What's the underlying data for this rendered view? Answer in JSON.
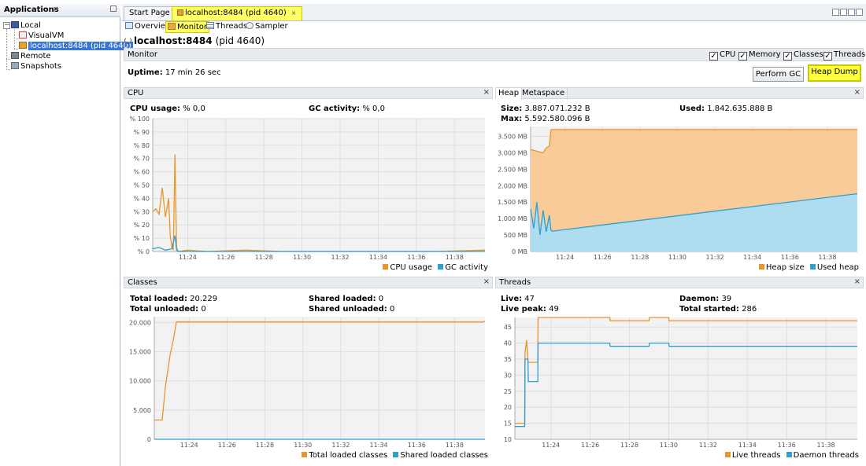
{
  "left_panel": {
    "title": "Applications",
    "close": "×",
    "items": [
      {
        "label": "Local"
      },
      {
        "label": "VisualVM"
      },
      {
        "label": "localhost:8484 (pid 4640)"
      },
      {
        "label": "Remote"
      },
      {
        "label": "Snapshots"
      }
    ]
  },
  "tabs": [
    {
      "label": "Start Page",
      "close": "×"
    },
    {
      "label": "localhost:8484 (pid 4640)",
      "close": "×"
    }
  ],
  "subtabs": [
    {
      "label": "Overview"
    },
    {
      "label": "Monitor"
    },
    {
      "label": "Threads"
    },
    {
      "label": "Sampler"
    }
  ],
  "vm": {
    "title": "localhost:8484",
    "pid": "(pid 4640)"
  },
  "monitor": {
    "label": "Monitor",
    "checkboxes": [
      {
        "label": "CPU",
        "checked": true
      },
      {
        "label": "Memory",
        "checked": true
      },
      {
        "label": "Classes",
        "checked": true
      },
      {
        "label": "Threads",
        "checked": true
      }
    ],
    "uptime_label": "Uptime:",
    "uptime_value": "17 min 26 sec",
    "perform_gc": "Perform GC",
    "heap_dump": "Heap Dump"
  },
  "panels": {
    "cpu": {
      "title": "CPU",
      "close": "×",
      "stats": [
        {
          "label": "CPU usage:",
          "value": "% 0,0"
        },
        {
          "label": "GC activity:",
          "value": "% 0,0"
        }
      ],
      "legend": [
        {
          "label": "CPU usage",
          "color": "#e8962c"
        },
        {
          "label": "GC activity",
          "color": "#2f9fd0"
        }
      ]
    },
    "heap": {
      "tabs": [
        "Heap",
        "Metaspace"
      ],
      "close": "×",
      "stats": [
        {
          "label": "Size:",
          "value": "3.887.071.232 B"
        },
        {
          "label": "Used:",
          "value": "1.842.635.888 B"
        },
        {
          "label": "Max:",
          "value": "5.592.580.096 B"
        }
      ],
      "legend": [
        {
          "label": "Heap size",
          "color": "#e8962c"
        },
        {
          "label": "Used heap",
          "color": "#2f9fd0"
        }
      ]
    },
    "classes": {
      "title": "Classes",
      "close": "×",
      "stats": [
        {
          "label": "Total loaded:",
          "value": "20.229"
        },
        {
          "label": "Shared loaded:",
          "value": "0"
        },
        {
          "label": "Total unloaded:",
          "value": "0"
        },
        {
          "label": "Shared unloaded:",
          "value": "0"
        }
      ],
      "legend": [
        {
          "label": "Total loaded classes",
          "color": "#e8962c"
        },
        {
          "label": "Shared loaded classes",
          "color": "#2f9fd0"
        }
      ]
    },
    "threads": {
      "title": "Threads",
      "close": "×",
      "stats": [
        {
          "label": "Live:",
          "value": "47"
        },
        {
          "label": "Daemon:",
          "value": "39"
        },
        {
          "label": "Live peak:",
          "value": "49"
        },
        {
          "label": "Total started:",
          "value": "286"
        }
      ],
      "legend": [
        {
          "label": "Live threads",
          "color": "#e8962c"
        },
        {
          "label": "Daemon threads",
          "color": "#2f9fd0"
        }
      ]
    }
  },
  "chart_data": [
    {
      "id": "cpu",
      "type": "line",
      "x_ticks": [
        "11:24",
        "11:26",
        "11:28",
        "11:30",
        "11:32",
        "11:34",
        "11:36",
        "11:38"
      ],
      "y_ticks": [
        "% 0",
        "% 10",
        "% 20",
        "% 30",
        "% 40",
        "% 50",
        "% 60",
        "% 70",
        "% 80",
        "% 90",
        "% 100"
      ],
      "x_range": [
        "11:22:10",
        "11:39:36"
      ],
      "ylim": [
        0,
        100
      ],
      "grid": true,
      "legend_position": "bottom-right",
      "series": [
        {
          "name": "CPU usage",
          "color": "#e8962c",
          "x": [
            "11:22:10",
            "11:22:20",
            "11:22:30",
            "11:22:40",
            "11:22:50",
            "11:23:00",
            "11:23:05",
            "11:23:10",
            "11:23:15",
            "11:23:20",
            "11:23:25",
            "11:23:30",
            "11:24:00",
            "11:25:00",
            "11:27:00",
            "11:29:00",
            "11:31:00",
            "11:33:00",
            "11:35:00",
            "11:37:00",
            "11:39:36"
          ],
          "values": [
            30,
            32,
            28,
            48,
            26,
            40,
            12,
            4,
            1,
            73,
            3,
            0,
            1,
            0,
            1,
            0,
            0,
            0,
            0,
            0,
            1
          ]
        },
        {
          "name": "GC activity",
          "color": "#2f9fd0",
          "x": [
            "11:22:10",
            "11:22:30",
            "11:22:50",
            "11:23:10",
            "11:23:20",
            "11:23:25",
            "11:23:30",
            "11:39:36"
          ],
          "values": [
            2,
            3,
            1,
            2,
            12,
            1,
            0,
            0
          ]
        }
      ]
    },
    {
      "id": "heap",
      "type": "area",
      "x_ticks": [
        "11:24",
        "11:26",
        "11:28",
        "11:30",
        "11:32",
        "11:34",
        "11:36",
        "11:38"
      ],
      "y_ticks": [
        "0 MB",
        "500 MB",
        "1.000 MB",
        "1.500 MB",
        "2.000 MB",
        "2.500 MB",
        "3.000 MB",
        "3.500 MB"
      ],
      "x_range": [
        "11:22:10",
        "11:39:36"
      ],
      "ylim": [
        0,
        3800
      ],
      "grid": true,
      "legend_position": "bottom-right",
      "series": [
        {
          "name": "Heap size",
          "color": "#e8962c",
          "x": [
            "11:22:10",
            "11:22:30",
            "11:22:50",
            "11:23:00",
            "11:23:10",
            "11:23:15",
            "11:23:20",
            "11:39:36"
          ],
          "values": [
            3100,
            3050,
            3000,
            3150,
            3200,
            3700,
            3707,
            3707
          ]
        },
        {
          "name": "Used heap",
          "color": "#2f9fd0",
          "x": [
            "11:22:10",
            "11:22:20",
            "11:22:30",
            "11:22:40",
            "11:22:50",
            "11:23:00",
            "11:23:10",
            "11:23:15",
            "11:23:20",
            "11:39:36"
          ],
          "values": [
            1300,
            700,
            1500,
            500,
            1250,
            600,
            1100,
            650,
            620,
            1757
          ]
        }
      ]
    },
    {
      "id": "classes",
      "type": "line",
      "x_ticks": [
        "11:24",
        "11:26",
        "11:28",
        "11:30",
        "11:32",
        "11:34",
        "11:36",
        "11:38"
      ],
      "y_ticks": [
        "0",
        "5.000",
        "10.000",
        "15.000",
        "20.000"
      ],
      "x_range": [
        "11:22:10",
        "11:39:36"
      ],
      "ylim": [
        0,
        21000
      ],
      "grid": true,
      "legend_position": "bottom-right",
      "series": [
        {
          "name": "Total loaded classes",
          "color": "#e8962c",
          "x": [
            "11:22:10",
            "11:22:35",
            "11:22:45",
            "11:23:00",
            "11:23:10",
            "11:23:20",
            "11:39:30",
            "11:39:36"
          ],
          "values": [
            3300,
            3300,
            9000,
            14500,
            17000,
            20100,
            20100,
            20229
          ]
        },
        {
          "name": "Shared loaded classes",
          "color": "#2f9fd0",
          "x": [
            "11:22:10",
            "11:39:36"
          ],
          "values": [
            0,
            0
          ]
        }
      ]
    },
    {
      "id": "threads",
      "type": "line",
      "x_ticks": [
        "11:24",
        "11:26",
        "11:28",
        "11:30",
        "11:32",
        "11:34",
        "11:36",
        "11:38"
      ],
      "y_ticks": [
        "10",
        "15",
        "20",
        "25",
        "30",
        "35",
        "40",
        "45"
      ],
      "x_range": [
        "11:22:10",
        "11:39:36"
      ],
      "ylim": [
        10,
        48
      ],
      "grid": true,
      "legend_position": "bottom-right",
      "series": [
        {
          "name": "Live threads",
          "color": "#e8962c",
          "x": [
            "11:22:10",
            "11:22:40",
            "11:22:41",
            "11:22:46",
            "11:22:50",
            "11:22:51",
            "11:23:20",
            "11:23:21",
            "11:27:00",
            "11:27:01",
            "11:29:00",
            "11:29:01",
            "11:30:00",
            "11:30:01",
            "11:39:36"
          ],
          "values": [
            15,
            15,
            37,
            41,
            34,
            34,
            34,
            48,
            48,
            47,
            47,
            48,
            48,
            47,
            47
          ]
        },
        {
          "name": "Daemon threads",
          "color": "#2f9fd0",
          "x": [
            "11:22:10",
            "11:22:40",
            "11:22:41",
            "11:22:50",
            "11:22:51",
            "11:23:20",
            "11:23:21",
            "11:27:00",
            "11:27:01",
            "11:29:00",
            "11:29:01",
            "11:30:00",
            "11:30:01",
            "11:39:36"
          ],
          "values": [
            14,
            14,
            35,
            35,
            28,
            28,
            40,
            40,
            39,
            39,
            40,
            40,
            39,
            39
          ]
        }
      ]
    }
  ]
}
